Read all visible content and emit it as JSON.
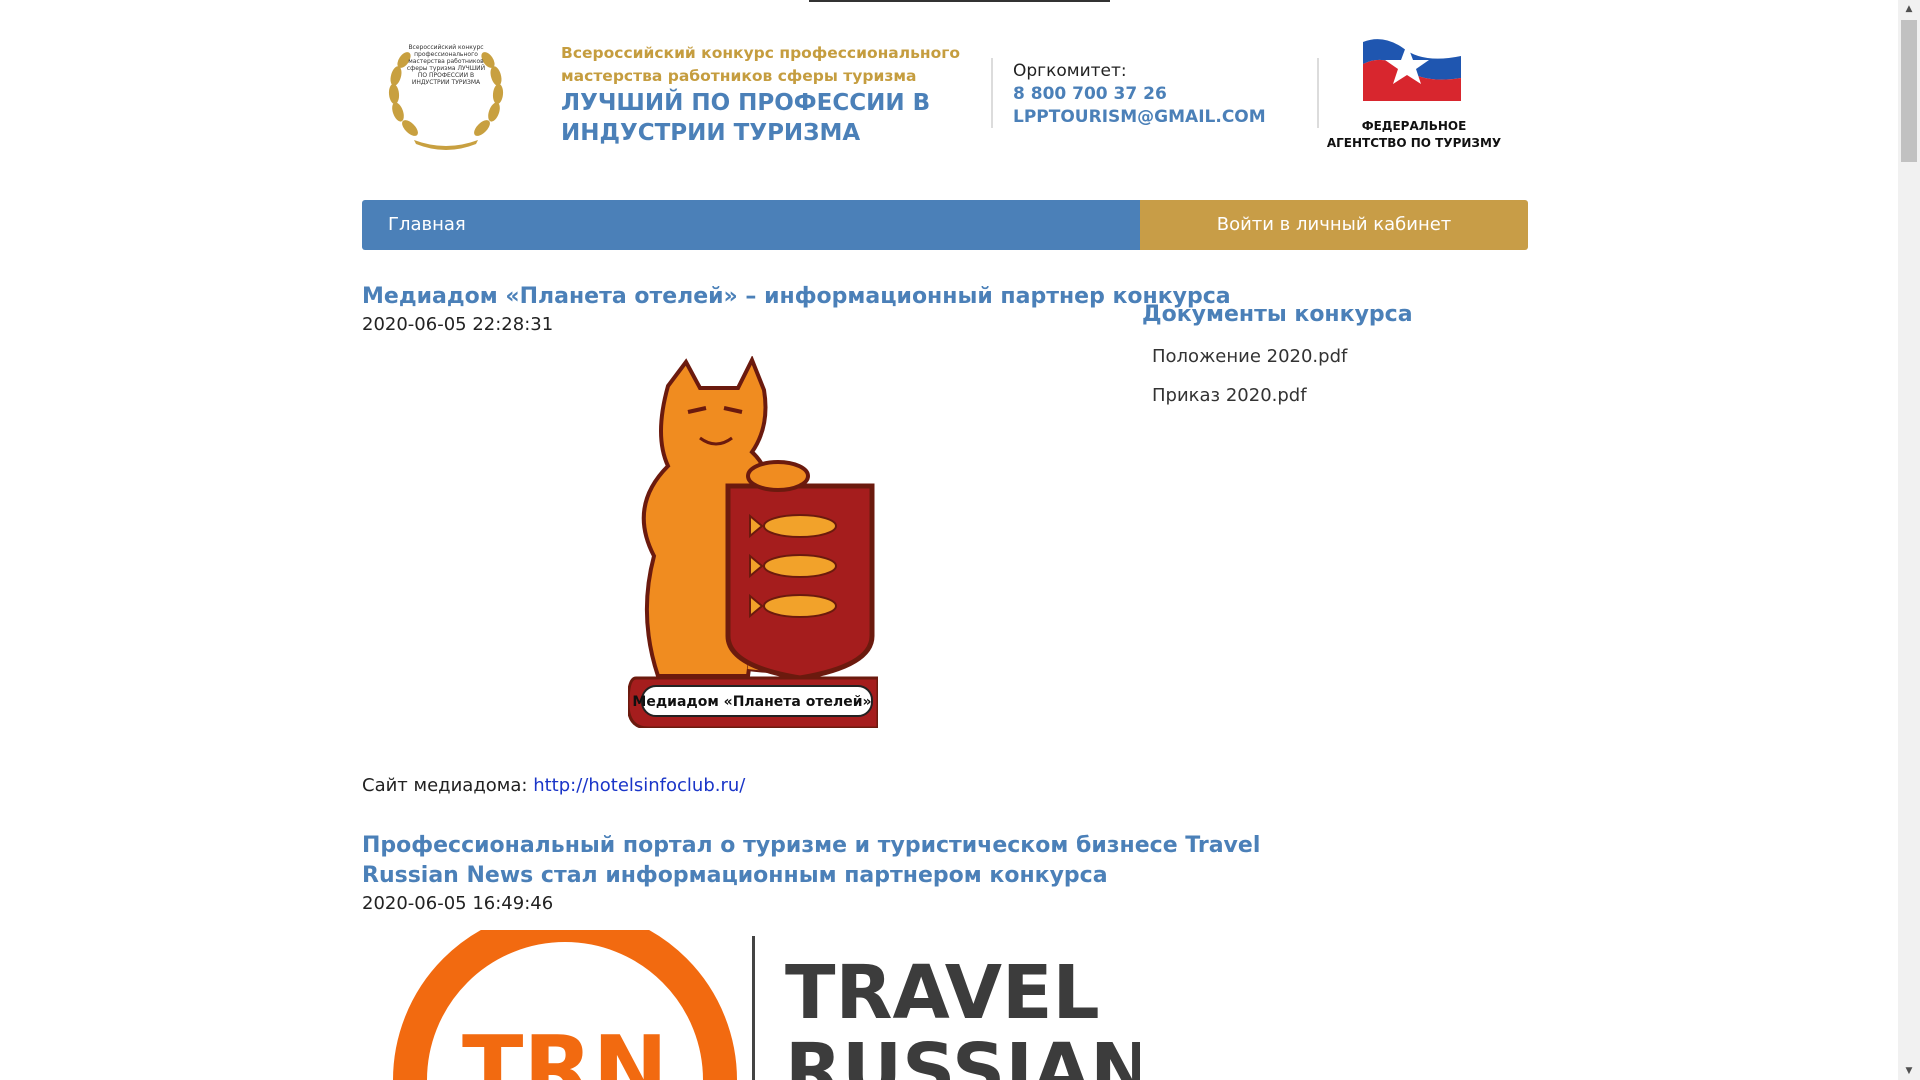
{
  "header": {
    "laurel_text": "Всероссийский конкурс профессионального мастерства работников сферы туризма ЛУЧШИЙ ПО ПРОФЕССИИ В ИНДУСТРИИ ТУРИЗМА",
    "contest_subtitle": "Всероссийский конкурс профессионального мастерства работников сферы туризма",
    "contest_title": "ЛУЧШИЙ ПО ПРОФЕССИИ В ИНДУСТРИИ ТУРИЗМА",
    "org_label": "Оргкомитет:",
    "org_phone": "8 800 700 37 26",
    "org_email": "LPPTOURISM@GMAIL.COM",
    "agency_name": "ФЕДЕРАЛЬНОЕ АГЕНТСТВО ПО ТУРИЗМУ"
  },
  "nav": {
    "home_label": "Главная",
    "login_label": "Войти в личный кабинет"
  },
  "articles": [
    {
      "title": "Медиадом «Планета отелей» – информационный партнер конкурса",
      "date": "2020-06-05 22:28:31",
      "image_caption": "Медиадом «Планета отелей»",
      "site_label": "Сайт медиадома:",
      "site_link": "http://hotelsinfoclub.ru/"
    },
    {
      "title_line1": "Профессиональный портал о туризме и туристическом бизнесе Travel",
      "title_line2": "Russian News стал информационным партнером конкурса",
      "date": "2020-06-05 16:49:46",
      "logo_abbr": "TRN",
      "logo_word1": "TRAVEL",
      "logo_word2": "RUSSIAN"
    }
  ],
  "sidebar": {
    "title": "Документы конкурса",
    "docs": [
      "Положение 2020.pdf",
      "Приказ 2020.pdf"
    ]
  },
  "colors": {
    "brand_blue": "#4b80b8",
    "brand_gold": "#c89d47",
    "link_blue": "#1a35c8"
  },
  "icons": {
    "scroll_up": "▲",
    "scroll_down": "▼"
  }
}
